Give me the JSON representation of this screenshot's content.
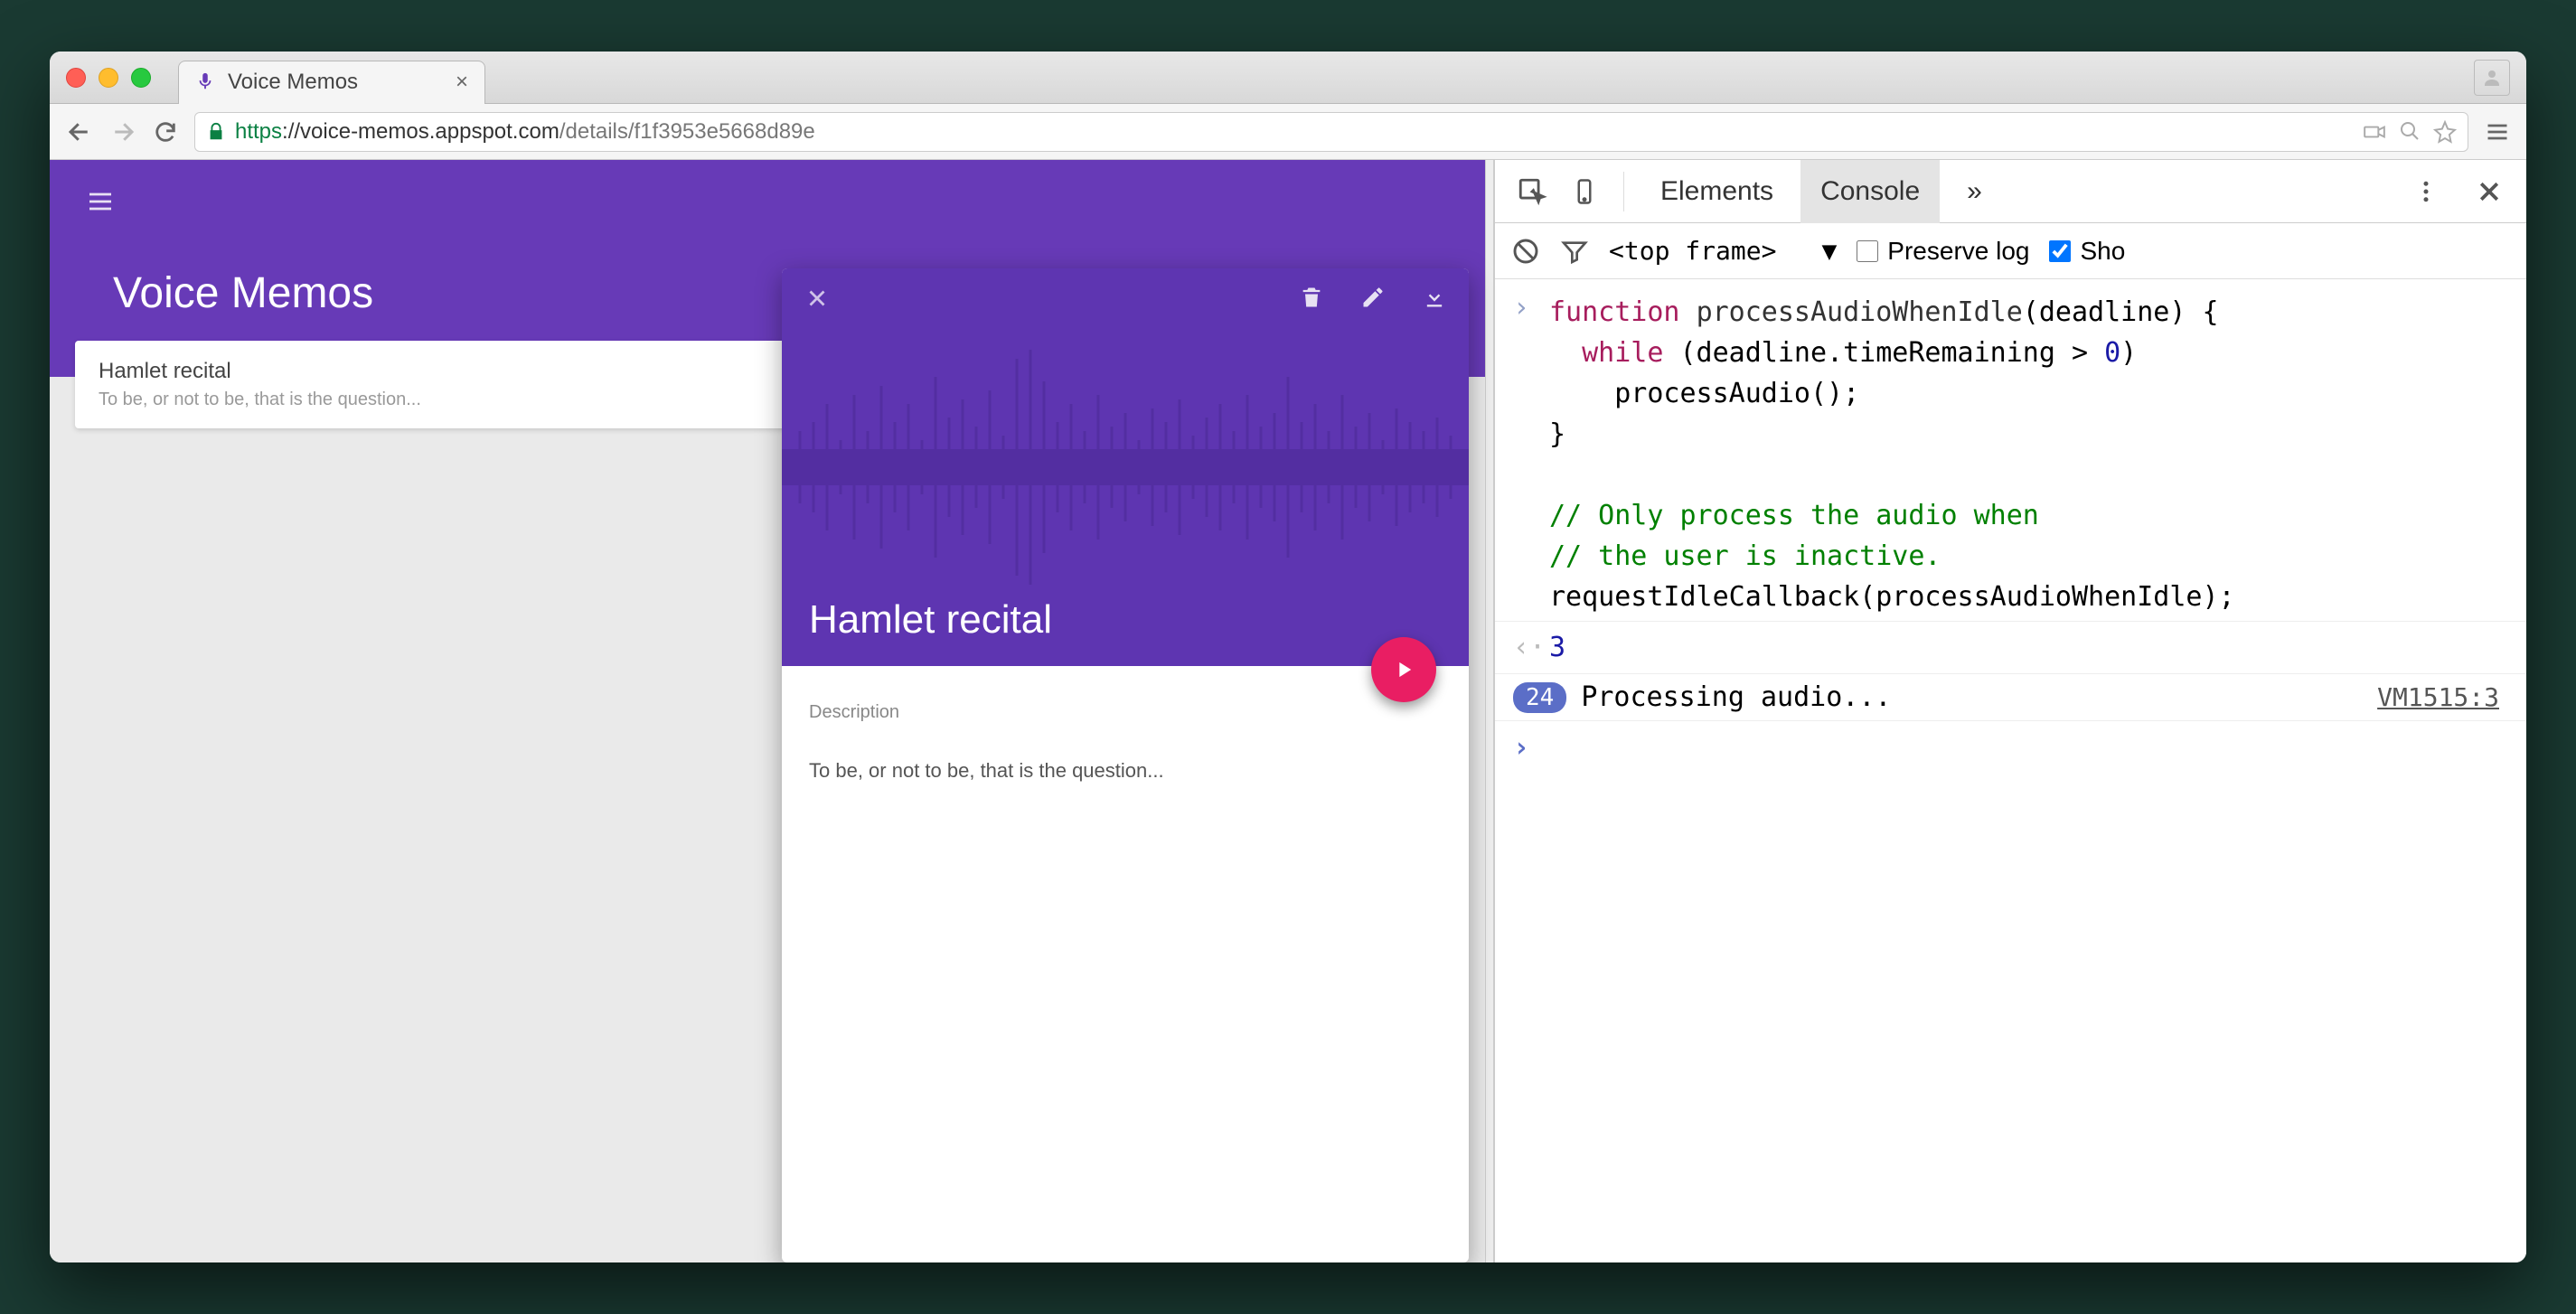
{
  "browser": {
    "tab_title": "Voice Memos",
    "url_scheme": "https",
    "url_host": "://voice-memos.appspot.com",
    "url_path": "/details/f1f3953e5668d89e"
  },
  "app": {
    "title": "Voice Memos",
    "list": [
      {
        "title": "Hamlet recital",
        "subtitle": "To be, or not to be, that is the question..."
      }
    ],
    "detail": {
      "title": "Hamlet recital",
      "description_label": "Description",
      "description": "To be, or not to be, that is the question..."
    }
  },
  "devtools": {
    "tabs": {
      "elements": "Elements",
      "console": "Console",
      "more": "»"
    },
    "toolbar": {
      "frame": "<top frame>",
      "preserve_log": "Preserve log",
      "show": "Sho"
    },
    "code_lines": [
      "function processAudioWhenIdle(deadline) {",
      "  while (deadline.timeRemaining > 0)",
      "    processAudio();",
      "}",
      "",
      "// Only process the audio when",
      "// the user is inactive.",
      "requestIdleCallback(processAudioWhenIdle);"
    ],
    "result": "3",
    "log": {
      "count": "24",
      "message": "Processing audio...",
      "source": "VM1515:3"
    }
  }
}
